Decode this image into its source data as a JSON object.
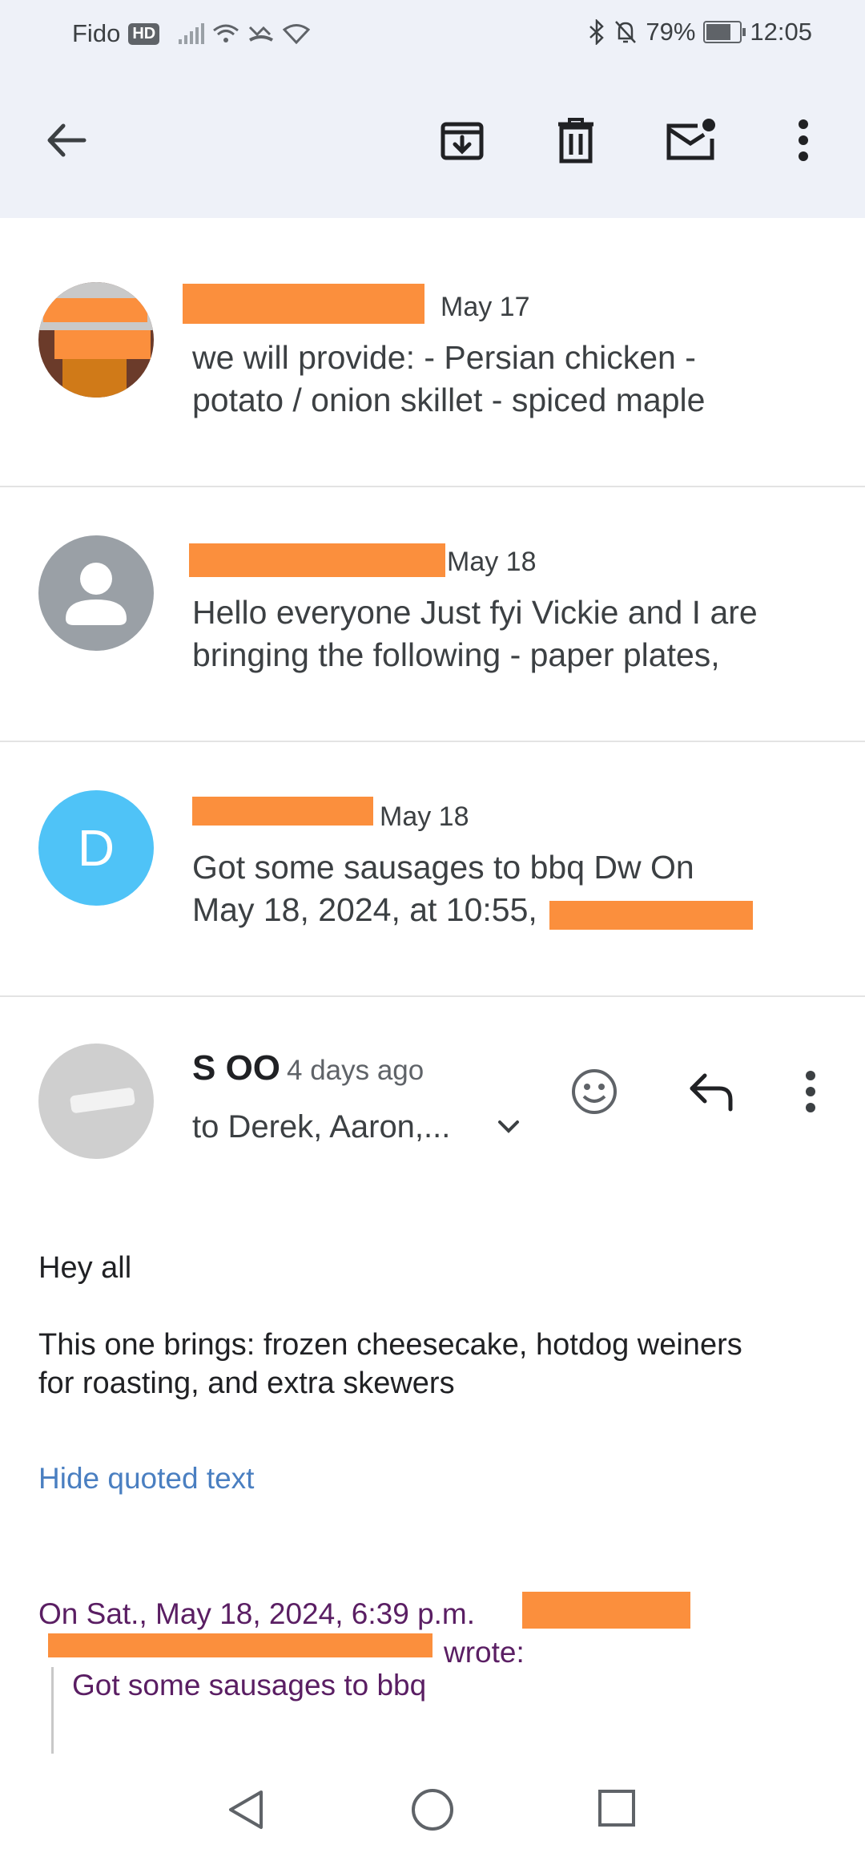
{
  "status_bar": {
    "carrier": "Fido",
    "hd": "HD",
    "battery": "79%",
    "time": "12:05"
  },
  "toolbar": {
    "icons": [
      "back-arrow-icon",
      "archive-icon",
      "delete-icon",
      "mark-unread-icon",
      "more-vert-icon"
    ]
  },
  "messages": [
    {
      "date": "May 17",
      "snippet_line1": "we will provide: - Persian chicken -",
      "snippet_line2": "potato / onion skillet - spiced maple"
    },
    {
      "date": "May 18",
      "snippet_line1": "Hello everyone Just fyi Vickie and I are",
      "snippet_line2": "bringing the following - paper plates,"
    },
    {
      "avatar_letter": "D",
      "date": "May 18",
      "snippet_line1": "Got some sausages to bbq Dw On",
      "snippet_line2": "May 18, 2024, at 10:55,"
    }
  ],
  "open_message": {
    "sender": "S OO",
    "time_ago": "4 days ago",
    "recipients": "to Derek, Aaron,...",
    "greeting": "Hey all",
    "body_line1": "This one brings: frozen cheesecake, hotdog weiners",
    "body_line2": "for roasting, and extra skewers",
    "hide_quoted": "Hide quoted text",
    "quote_header_line1": "On Sat., May 18, 2024, 6:39 p.m.",
    "quote_header_wrote": "wrote:",
    "quote_text": "Got some sausages to bbq"
  },
  "colors": {
    "accent_link": "#4a7fc1",
    "quote_text": "#5a1e63",
    "redaction": "#fb8f3d",
    "avatar_d": "#4fc3f7",
    "toolbar_bg": "#eef1f8"
  }
}
